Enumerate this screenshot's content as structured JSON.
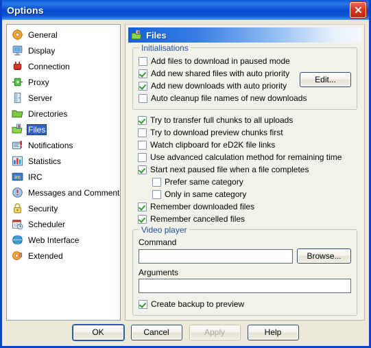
{
  "window": {
    "title": "Options",
    "close_label": "Close"
  },
  "sidebar": {
    "items": [
      {
        "label": "General",
        "icon": "gear-icon"
      },
      {
        "label": "Display",
        "icon": "monitor-icon"
      },
      {
        "label": "Connection",
        "icon": "plug-icon"
      },
      {
        "label": "Proxy",
        "icon": "proxy-icon"
      },
      {
        "label": "Server",
        "icon": "server-icon"
      },
      {
        "label": "Directories",
        "icon": "folder-icon"
      },
      {
        "label": "Files",
        "icon": "files-icon",
        "selected": true
      },
      {
        "label": "Notifications",
        "icon": "notification-icon"
      },
      {
        "label": "Statistics",
        "icon": "statistics-icon"
      },
      {
        "label": "IRC",
        "icon": "irc-icon"
      },
      {
        "label": "Messages and Comments",
        "icon": "message-icon"
      },
      {
        "label": "Security",
        "icon": "lock-icon"
      },
      {
        "label": "Scheduler",
        "icon": "calendar-clock-icon"
      },
      {
        "label": "Web Interface",
        "icon": "globe-icon"
      },
      {
        "label": "Extended",
        "icon": "extended-gear-icon"
      }
    ]
  },
  "panel": {
    "header_title": "Files",
    "header_icon": "files-icon",
    "initialisations": {
      "legend": "Initialisations",
      "checkboxes": [
        {
          "label": "Add files to download in paused mode",
          "checked": false
        },
        {
          "label": "Add new shared files with auto priority",
          "checked": true
        },
        {
          "label": "Add new downloads with auto priority",
          "checked": true
        },
        {
          "label": "Auto cleanup file names of new downloads",
          "checked": false
        }
      ],
      "edit_button": "Edit..."
    },
    "options": [
      {
        "label": "Try to transfer full chunks to all uploads",
        "checked": true,
        "indent": false
      },
      {
        "label": "Try to download preview chunks first",
        "checked": false,
        "indent": false
      },
      {
        "label": "Watch clipboard for eD2K file links",
        "checked": false,
        "indent": false
      },
      {
        "label": "Use advanced calculation method for remaining time",
        "checked": false,
        "indent": false
      },
      {
        "label": "Start next paused file when a file completes",
        "checked": true,
        "indent": false
      },
      {
        "label": "Prefer same category",
        "checked": false,
        "indent": true
      },
      {
        "label": "Only in same category",
        "checked": false,
        "indent": true
      },
      {
        "label": "Remember downloaded files",
        "checked": true,
        "indent": false
      },
      {
        "label": "Remember cancelled files",
        "checked": true,
        "indent": false
      }
    ],
    "video_player": {
      "legend": "Video player",
      "command_label": "Command",
      "command_value": "",
      "browse_button": "Browse...",
      "arguments_label": "Arguments",
      "arguments_value": "",
      "backup_checkbox": {
        "label": "Create backup to preview",
        "checked": true
      }
    }
  },
  "footer": {
    "ok": "OK",
    "cancel": "Cancel",
    "apply": "Apply",
    "help": "Help"
  },
  "colors": {
    "titlebar_blue": "#0a49cf",
    "selection_blue": "#3062c8",
    "legend_blue": "#1c4fa8",
    "dialog_bg": "#ece9d8",
    "panel_bg": "#f2f1ea",
    "check_green": "#2f9e2f",
    "close_red": "#d93a20"
  }
}
